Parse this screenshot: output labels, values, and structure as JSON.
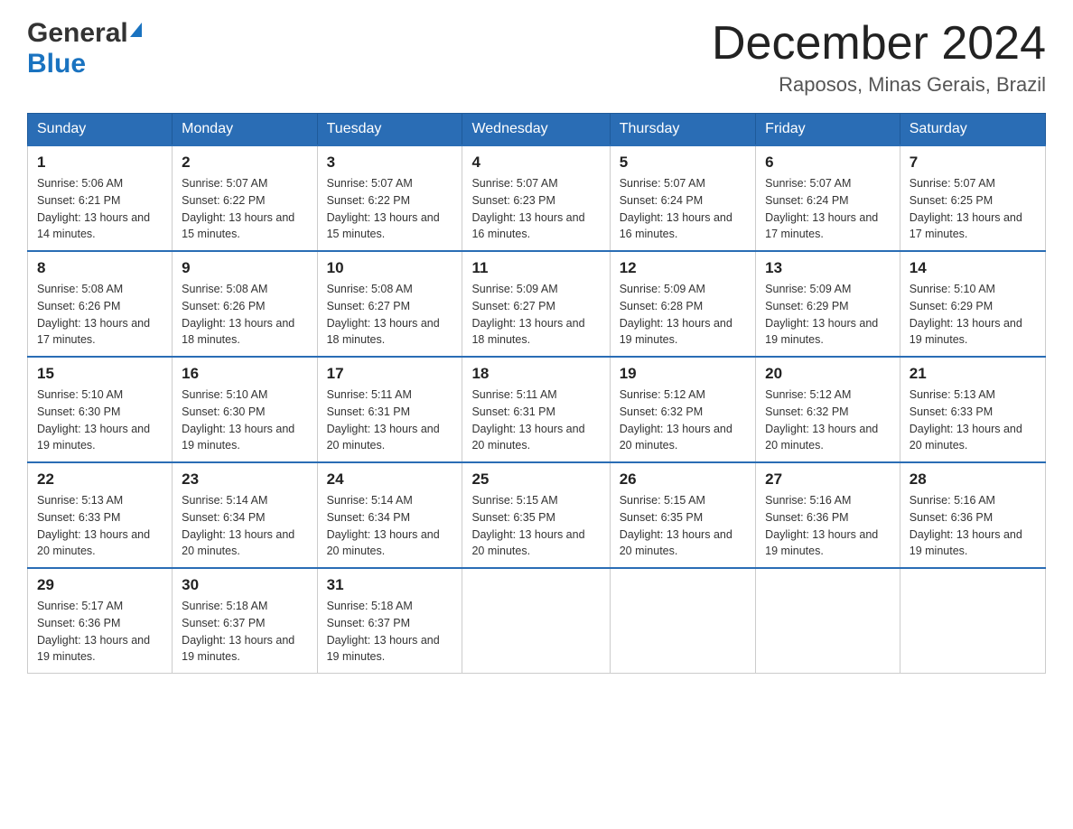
{
  "header": {
    "logo_general": "General",
    "logo_blue": "Blue",
    "month_title": "December 2024",
    "location": "Raposos, Minas Gerais, Brazil"
  },
  "days_of_week": [
    "Sunday",
    "Monday",
    "Tuesday",
    "Wednesday",
    "Thursday",
    "Friday",
    "Saturday"
  ],
  "weeks": [
    [
      {
        "day": "1",
        "sunrise": "5:06 AM",
        "sunset": "6:21 PM",
        "daylight": "13 hours and 14 minutes."
      },
      {
        "day": "2",
        "sunrise": "5:07 AM",
        "sunset": "6:22 PM",
        "daylight": "13 hours and 15 minutes."
      },
      {
        "day": "3",
        "sunrise": "5:07 AM",
        "sunset": "6:22 PM",
        "daylight": "13 hours and 15 minutes."
      },
      {
        "day": "4",
        "sunrise": "5:07 AM",
        "sunset": "6:23 PM",
        "daylight": "13 hours and 16 minutes."
      },
      {
        "day": "5",
        "sunrise": "5:07 AM",
        "sunset": "6:24 PM",
        "daylight": "13 hours and 16 minutes."
      },
      {
        "day": "6",
        "sunrise": "5:07 AM",
        "sunset": "6:24 PM",
        "daylight": "13 hours and 17 minutes."
      },
      {
        "day": "7",
        "sunrise": "5:07 AM",
        "sunset": "6:25 PM",
        "daylight": "13 hours and 17 minutes."
      }
    ],
    [
      {
        "day": "8",
        "sunrise": "5:08 AM",
        "sunset": "6:26 PM",
        "daylight": "13 hours and 17 minutes."
      },
      {
        "day": "9",
        "sunrise": "5:08 AM",
        "sunset": "6:26 PM",
        "daylight": "13 hours and 18 minutes."
      },
      {
        "day": "10",
        "sunrise": "5:08 AM",
        "sunset": "6:27 PM",
        "daylight": "13 hours and 18 minutes."
      },
      {
        "day": "11",
        "sunrise": "5:09 AM",
        "sunset": "6:27 PM",
        "daylight": "13 hours and 18 minutes."
      },
      {
        "day": "12",
        "sunrise": "5:09 AM",
        "sunset": "6:28 PM",
        "daylight": "13 hours and 19 minutes."
      },
      {
        "day": "13",
        "sunrise": "5:09 AM",
        "sunset": "6:29 PM",
        "daylight": "13 hours and 19 minutes."
      },
      {
        "day": "14",
        "sunrise": "5:10 AM",
        "sunset": "6:29 PM",
        "daylight": "13 hours and 19 minutes."
      }
    ],
    [
      {
        "day": "15",
        "sunrise": "5:10 AM",
        "sunset": "6:30 PM",
        "daylight": "13 hours and 19 minutes."
      },
      {
        "day": "16",
        "sunrise": "5:10 AM",
        "sunset": "6:30 PM",
        "daylight": "13 hours and 19 minutes."
      },
      {
        "day": "17",
        "sunrise": "5:11 AM",
        "sunset": "6:31 PM",
        "daylight": "13 hours and 20 minutes."
      },
      {
        "day": "18",
        "sunrise": "5:11 AM",
        "sunset": "6:31 PM",
        "daylight": "13 hours and 20 minutes."
      },
      {
        "day": "19",
        "sunrise": "5:12 AM",
        "sunset": "6:32 PM",
        "daylight": "13 hours and 20 minutes."
      },
      {
        "day": "20",
        "sunrise": "5:12 AM",
        "sunset": "6:32 PM",
        "daylight": "13 hours and 20 minutes."
      },
      {
        "day": "21",
        "sunrise": "5:13 AM",
        "sunset": "6:33 PM",
        "daylight": "13 hours and 20 minutes."
      }
    ],
    [
      {
        "day": "22",
        "sunrise": "5:13 AM",
        "sunset": "6:33 PM",
        "daylight": "13 hours and 20 minutes."
      },
      {
        "day": "23",
        "sunrise": "5:14 AM",
        "sunset": "6:34 PM",
        "daylight": "13 hours and 20 minutes."
      },
      {
        "day": "24",
        "sunrise": "5:14 AM",
        "sunset": "6:34 PM",
        "daylight": "13 hours and 20 minutes."
      },
      {
        "day": "25",
        "sunrise": "5:15 AM",
        "sunset": "6:35 PM",
        "daylight": "13 hours and 20 minutes."
      },
      {
        "day": "26",
        "sunrise": "5:15 AM",
        "sunset": "6:35 PM",
        "daylight": "13 hours and 20 minutes."
      },
      {
        "day": "27",
        "sunrise": "5:16 AM",
        "sunset": "6:36 PM",
        "daylight": "13 hours and 19 minutes."
      },
      {
        "day": "28",
        "sunrise": "5:16 AM",
        "sunset": "6:36 PM",
        "daylight": "13 hours and 19 minutes."
      }
    ],
    [
      {
        "day": "29",
        "sunrise": "5:17 AM",
        "sunset": "6:36 PM",
        "daylight": "13 hours and 19 minutes."
      },
      {
        "day": "30",
        "sunrise": "5:18 AM",
        "sunset": "6:37 PM",
        "daylight": "13 hours and 19 minutes."
      },
      {
        "day": "31",
        "sunrise": "5:18 AM",
        "sunset": "6:37 PM",
        "daylight": "13 hours and 19 minutes."
      },
      null,
      null,
      null,
      null
    ]
  ]
}
